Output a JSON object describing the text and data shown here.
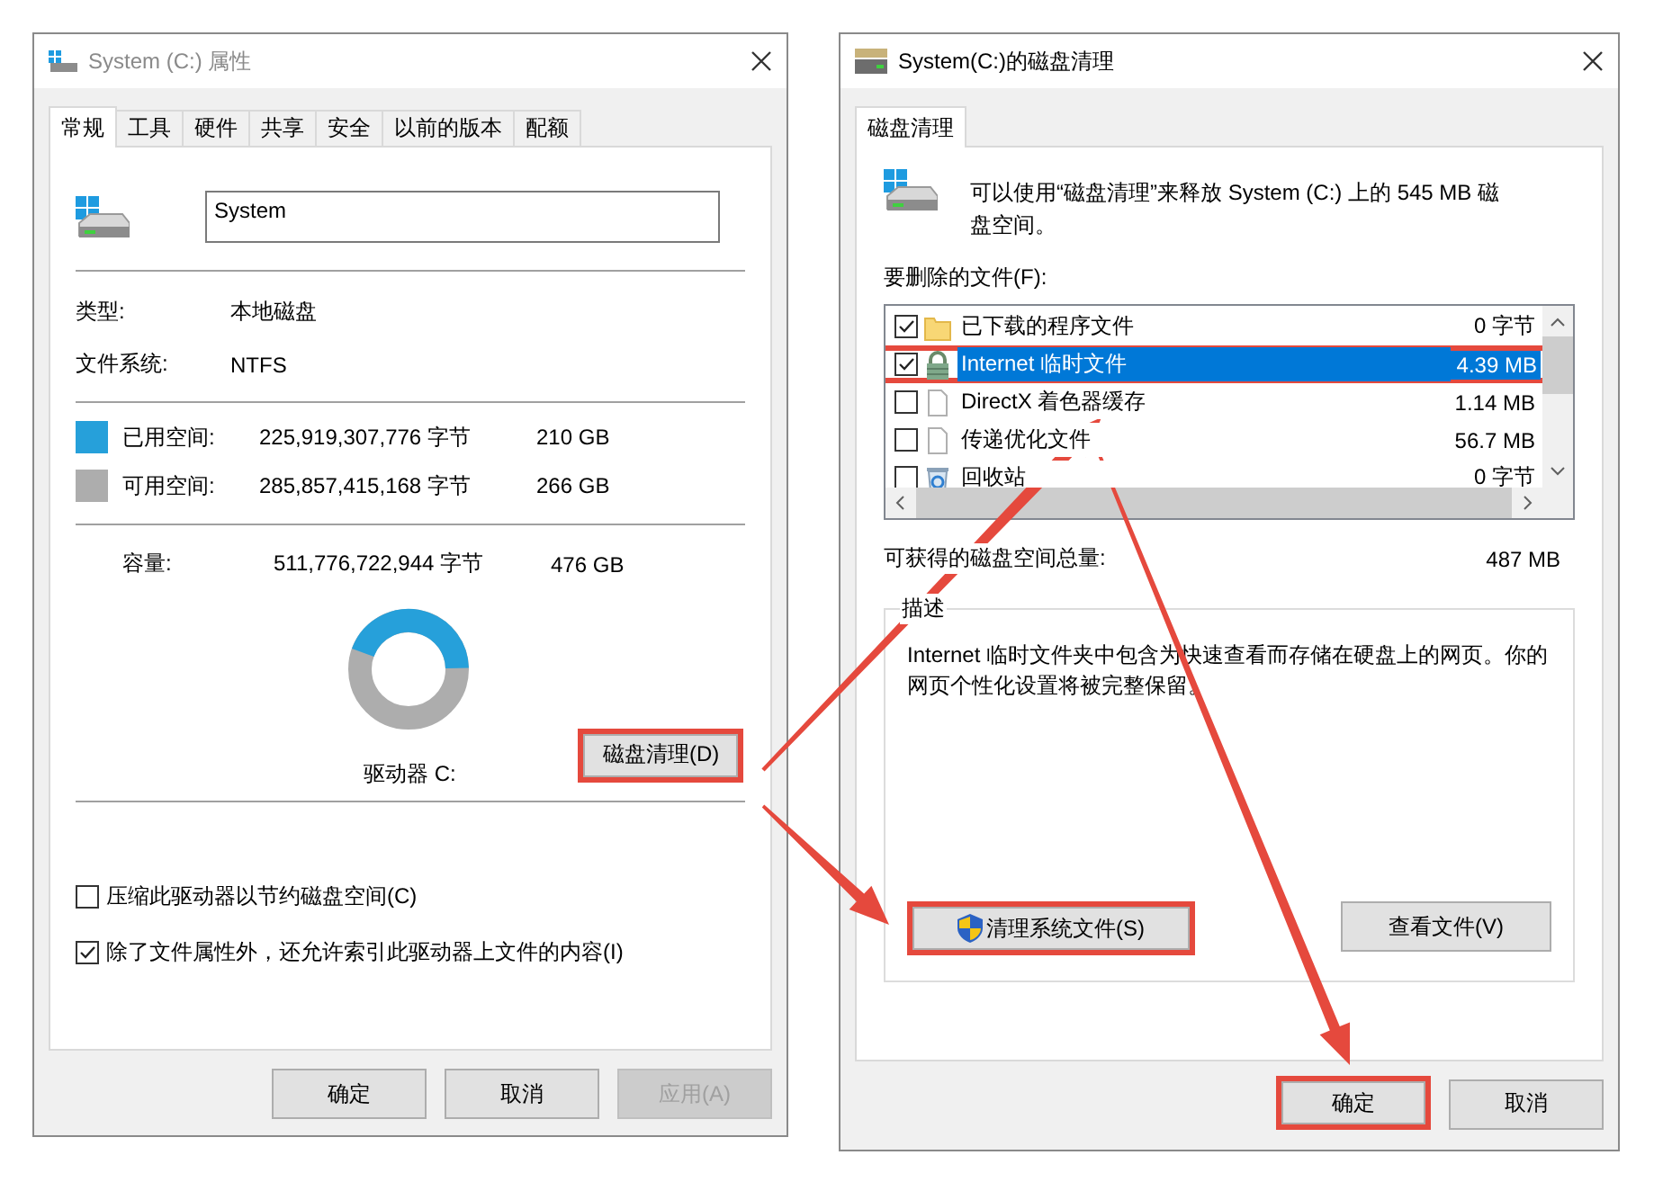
{
  "properties_window": {
    "title": "System (C:) 属性",
    "tabs": [
      {
        "label": "常规",
        "selected": true
      },
      {
        "label": "工具",
        "selected": false
      },
      {
        "label": "硬件",
        "selected": false
      },
      {
        "label": "共享",
        "selected": false
      },
      {
        "label": "安全",
        "selected": false
      },
      {
        "label": "以前的版本",
        "selected": false
      },
      {
        "label": "配额",
        "selected": false
      }
    ],
    "drive_name": {
      "value": "System"
    },
    "info": [
      {
        "label": "类型:",
        "value": "本地磁盘"
      },
      {
        "label": "文件系统:",
        "value": "NTFS"
      }
    ],
    "space": [
      {
        "label": "已用空间:",
        "bytes": "225,919,307,776 字节",
        "size": "210 GB",
        "color": "#26a0da"
      },
      {
        "label": "可用空间:",
        "bytes": "285,857,415,168 字节",
        "size": "266 GB",
        "color": "#adadad"
      }
    ],
    "capacity": {
      "label": "容量:",
      "bytes": "511,776,722,944 字节",
      "size": "476 GB"
    },
    "usage": {
      "level": 0.44
    },
    "drive_label": "驱动器 C:",
    "cleanup_button": {
      "label": "磁盘清理(D)",
      "highlighted": true
    },
    "options": [
      {
        "label": "压缩此驱动器以节约磁盘空间(C)",
        "checked": false
      },
      {
        "label": "除了文件属性外，还允许索引此驱动器上文件的内容(I)",
        "checked": true
      }
    ],
    "buttons": [
      {
        "label": "确定",
        "disabled": false
      },
      {
        "label": "取消",
        "disabled": false
      },
      {
        "label": "应用(A)",
        "disabled": true
      }
    ]
  },
  "cleanup_window": {
    "title": "System(C:)的磁盘清理",
    "tabs": [
      {
        "label": "磁盘清理",
        "selected": true
      }
    ],
    "summary": "可以使用“磁盘清理”来释放 System (C:) 上的 545 MB 磁盘空间。",
    "files_label": "要删除的文件(F):",
    "files": [
      {
        "kind": "folder",
        "name": "已下载的程序文件",
        "size": "0 字节",
        "checked": true,
        "selected": false,
        "highlighted": false
      },
      {
        "kind": "lock",
        "name": "Internet 临时文件",
        "size": "4.39 MB",
        "checked": true,
        "selected": true,
        "highlighted": true
      },
      {
        "kind": "file",
        "name": "DirectX 着色器缓存",
        "size": "1.14 MB",
        "checked": false,
        "selected": false,
        "highlighted": false
      },
      {
        "kind": "file",
        "name": "传递优化文件",
        "size": "56.7 MB",
        "checked": false,
        "selected": false,
        "highlighted": false
      },
      {
        "kind": "recycle",
        "name": "回收站",
        "size": "0 字节",
        "checked": false,
        "selected": false,
        "highlighted": false
      }
    ],
    "total": {
      "label": "可获得的磁盘空间总量:",
      "value": "487 MB"
    },
    "description": {
      "heading": "描述",
      "text": "Internet 临时文件夹中包含为快速查看而存储在硬盘上的网页。你的网页个性化设置将被完整保留。"
    },
    "actions": [
      {
        "kind": "shield",
        "label": "清理系统文件(S)",
        "highlighted": true
      },
      {
        "kind": "plain",
        "label": "查看文件(V)",
        "highlighted": false
      }
    ],
    "buttons": [
      {
        "label": "确定",
        "highlighted": true
      },
      {
        "label": "取消",
        "highlighted": false
      }
    ]
  }
}
